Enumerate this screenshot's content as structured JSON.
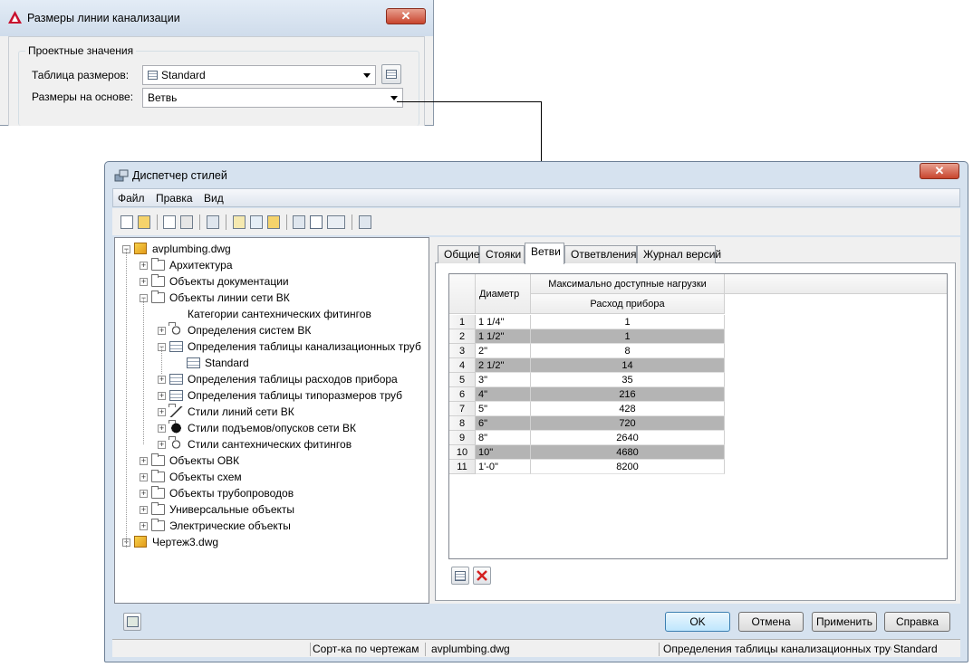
{
  "dialog_sizes": {
    "title": "Размеры линии канализации",
    "group_label": "Проектные значения",
    "table_label": "Таблица размеров:",
    "table_value": "Standard",
    "based_on_label": "Размеры на основе:",
    "based_on_value": "Ветвь",
    "close_glyph": "✕"
  },
  "style_manager": {
    "title": "Диспетчер стилей",
    "close_glyph": "✕",
    "menu": [
      "Файл",
      "Правка",
      "Вид"
    ],
    "tree": [
      {
        "label": "avplumbing.dwg",
        "level": 0,
        "icon": "dwg-icon",
        "exp": "−"
      },
      {
        "label": "Архитектура",
        "level": 1,
        "icon": "folder-icon",
        "exp": "+"
      },
      {
        "label": "Объекты документации",
        "level": 1,
        "icon": "folder-icon",
        "exp": "+"
      },
      {
        "label": "Объекты линии сети ВК",
        "level": 1,
        "icon": "folder-icon",
        "exp": "−"
      },
      {
        "label": "Категории сантехнических фитингов",
        "level": 2,
        "icon": "category-icon",
        "exp": ""
      },
      {
        "label": "Определения систем ВК",
        "level": 2,
        "icon": "system-icon",
        "exp": "+"
      },
      {
        "label": "Определения таблицы канализационных труб",
        "level": 2,
        "icon": "table-icon",
        "exp": "−"
      },
      {
        "label": "Standard",
        "level": 3,
        "icon": "table-icon",
        "exp": ""
      },
      {
        "label": "Определения таблицы расходов прибора",
        "level": 2,
        "icon": "table-icon",
        "exp": "+"
      },
      {
        "label": "Определения таблицы типоразмеров труб",
        "level": 2,
        "icon": "table-icon",
        "exp": "+"
      },
      {
        "label": "Стили линий сети ВК",
        "level": 2,
        "icon": "line-icon",
        "exp": "+"
      },
      {
        "label": "Стили подъемов/опусков сети ВК",
        "level": 2,
        "icon": "riser-icon",
        "exp": "+"
      },
      {
        "label": "Стили сантехнических фитингов",
        "level": 2,
        "icon": "fitting-icon",
        "exp": "+"
      },
      {
        "label": "Объекты ОВК",
        "level": 1,
        "icon": "folder-icon",
        "exp": "+"
      },
      {
        "label": "Объекты схем",
        "level": 1,
        "icon": "folder-icon",
        "exp": "+"
      },
      {
        "label": "Объекты трубопроводов",
        "level": 1,
        "icon": "folder-icon",
        "exp": "+"
      },
      {
        "label": "Универсальные объекты",
        "level": 1,
        "icon": "folder-icon",
        "exp": "+"
      },
      {
        "label": "Электрические объекты",
        "level": 1,
        "icon": "folder-icon",
        "exp": "+"
      },
      {
        "label": "Чертеж3.dwg",
        "level": 0,
        "icon": "dwg-icon",
        "exp": "+"
      }
    ],
    "tabs": [
      "Общие",
      "Стояки",
      "Ветви",
      "Ответвления",
      "Журнал версий"
    ],
    "active_tab": 2,
    "table": {
      "col1_header": "Диаметр",
      "col2_header_top": "Максимально доступные нагрузки",
      "col2_header_sub": "Расход прибора",
      "rows": [
        {
          "n": "1",
          "d": "1 1/4\"",
          "v": "1"
        },
        {
          "n": "2",
          "d": "1 1/2\"",
          "v": "1"
        },
        {
          "n": "3",
          "d": "2\"",
          "v": "8"
        },
        {
          "n": "4",
          "d": "2 1/2\"",
          "v": "14"
        },
        {
          "n": "5",
          "d": "3\"",
          "v": "35"
        },
        {
          "n": "6",
          "d": "4\"",
          "v": "216"
        },
        {
          "n": "7",
          "d": "5\"",
          "v": "428"
        },
        {
          "n": "8",
          "d": "6\"",
          "v": "720"
        },
        {
          "n": "9",
          "d": "8\"",
          "v": "2640"
        },
        {
          "n": "10",
          "d": "10\"",
          "v": "4680"
        },
        {
          "n": "11",
          "d": "1'-0\"",
          "v": "8200"
        }
      ]
    },
    "buttons": {
      "ok": "OK",
      "cancel": "Отмена",
      "apply": "Применить",
      "help": "Справка"
    },
    "status": {
      "sort": "Сорт-ка по чертежам",
      "file": "avplumbing.dwg",
      "definition": "Определения таблицы канализационных труб",
      "style": "Standard"
    },
    "colors": {
      "alt_row": "#b4b4b4",
      "accent": "#3c7fb1"
    }
  }
}
